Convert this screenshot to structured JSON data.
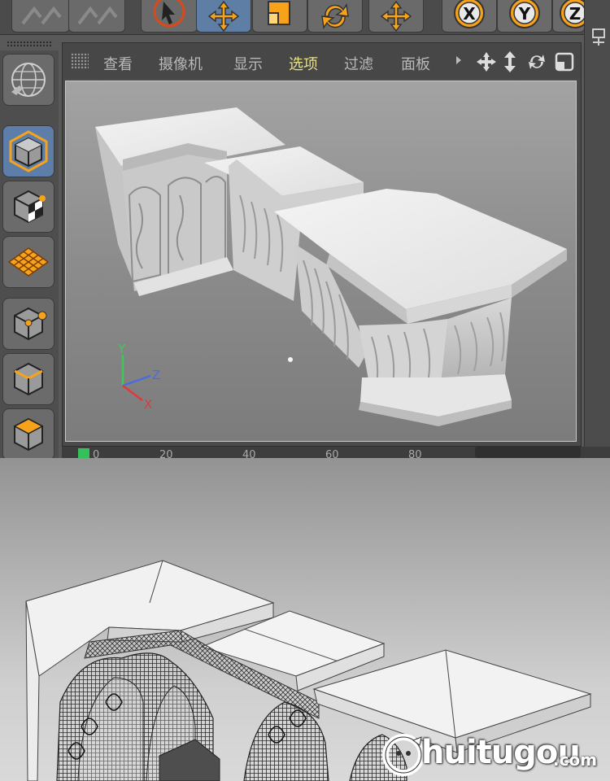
{
  "viewport_menu": {
    "items": [
      "查看",
      "摄像机",
      "显示",
      "选项",
      "过滤",
      "面板"
    ],
    "active": "选项"
  },
  "axes": {
    "y": "Y",
    "z": "Z",
    "x": "X"
  },
  "toolbar": {
    "icons": [
      "select-arrow-icon",
      "move-icon",
      "scale-icon",
      "rotate-icon",
      "move-alt-icon",
      "x-axis-lock-icon",
      "y-axis-lock-icon",
      "z-axis-lock-icon"
    ],
    "axis_labels": [
      "X",
      "Y",
      "Z"
    ]
  },
  "left_tools": [
    "model-mode-icon",
    "object-mode-icon",
    "texture-mode-icon",
    "workplane-mode-icon",
    "points-mode-icon",
    "edges-mode-icon",
    "polygons-mode-icon"
  ],
  "timeline": {
    "labels": [
      "0",
      "20",
      "40",
      "60",
      "80"
    ]
  },
  "watermark": {
    "text": "huitugou",
    "domain": ".com"
  },
  "colors": {
    "accent_orange": "#f7a21b",
    "active_blue": "#5c7ea9",
    "viewport_menu_active": "#e7e18e"
  }
}
